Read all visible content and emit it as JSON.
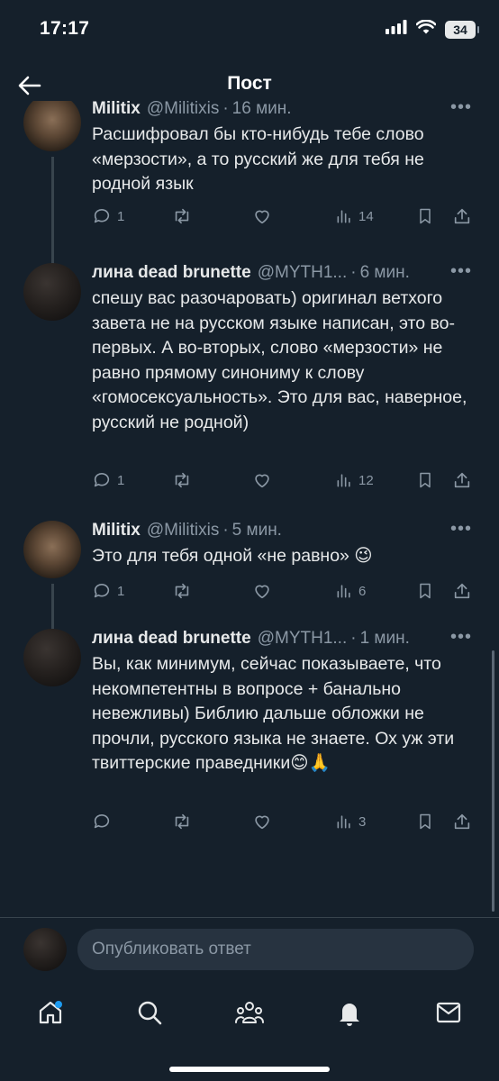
{
  "status_bar": {
    "time": "17:17",
    "battery": "34"
  },
  "header": {
    "title": "Пост"
  },
  "tweets": [
    {
      "name": "Militix",
      "handle": "@Militixis",
      "time": "16 мин.",
      "text": "Расшифровал бы кто-нибудь тебе слово «мерзости», а то русский же для тебя не родной язык",
      "replies": "1",
      "retweets": "",
      "likes": "",
      "views": "14"
    },
    {
      "name": "лина dead brunette",
      "handle": "@MYTH1...",
      "time": "6 мин.",
      "text": "спешу вас разочаровать) оригинал ветхого завета не на русском языке написан, это во-первых. А во-вторых, слово «мерзости» не равно прямому синониму к слову «гомосексуальность». Это для вас, наверное, русский не родной)",
      "replies": "1",
      "retweets": "",
      "likes": "",
      "views": "12"
    },
    {
      "name": "Militix",
      "handle": "@Militixis",
      "time": "5 мин.",
      "text": "Это для тебя одной «не равно» 😉",
      "replies": "1",
      "retweets": "",
      "likes": "",
      "views": "6"
    },
    {
      "name": "лина dead brunette",
      "handle": "@MYTH1...",
      "time": "1 мин.",
      "text": "Вы, как минимум, сейчас показываете, что некомпетентны в вопросе + банально невежливы) Библию дальше обложки не прочли, русского языка не знаете. Ох уж эти твиттерские праведники😊🙏",
      "replies": "",
      "retweets": "",
      "likes": "",
      "views": "3"
    }
  ],
  "composer": {
    "placeholder": "Опубликовать ответ"
  },
  "tabbar": {
    "items": [
      "home-icon",
      "search-icon",
      "communities-icon",
      "notifications-icon",
      "messages-icon"
    ]
  },
  "colors": {
    "background": "#15202b",
    "text": "#e7e9ea",
    "muted": "#8b98a5",
    "divider": "#38444d"
  }
}
